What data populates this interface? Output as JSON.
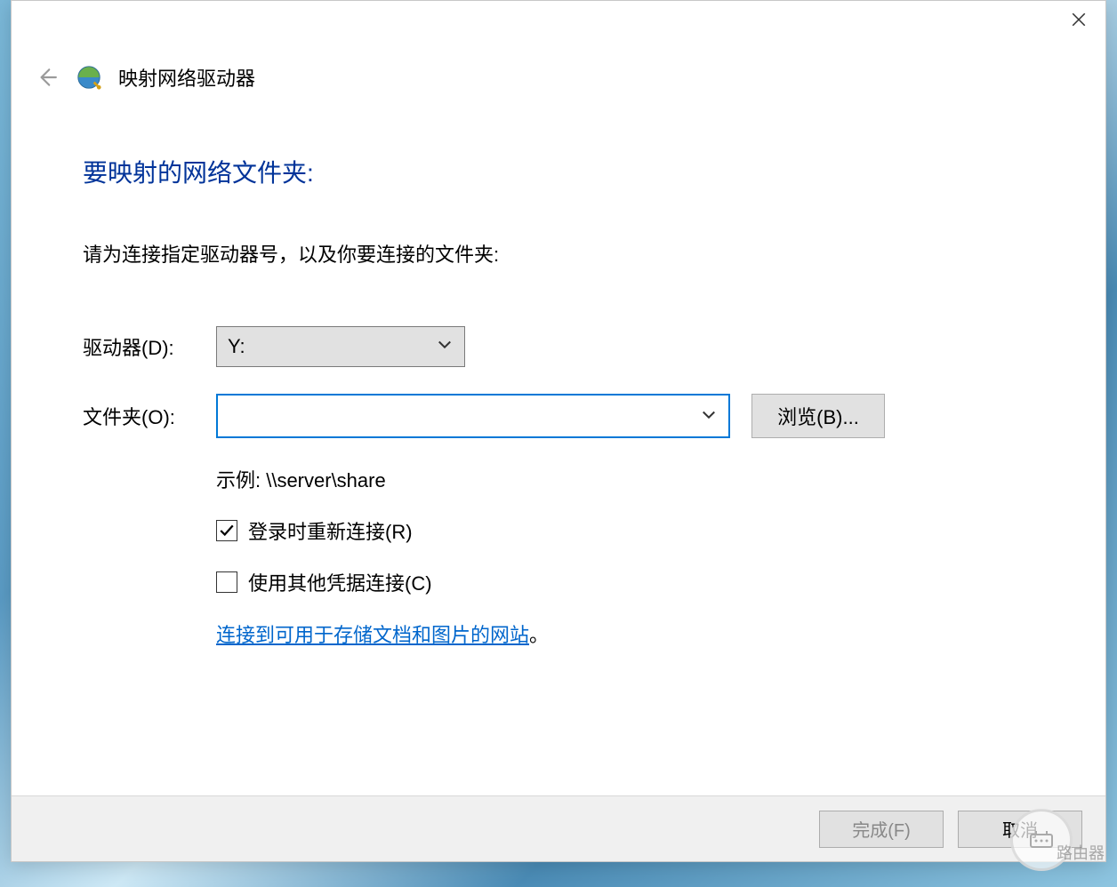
{
  "window": {
    "wizard_title": "映射网络驱动器"
  },
  "content": {
    "heading": "要映射的网络文件夹:",
    "instruction": "请为连接指定驱动器号，以及你要连接的文件夹:",
    "drive_label": "驱动器(D):",
    "drive_value": "Y:",
    "folder_label": "文件夹(O):",
    "folder_value": "",
    "browse_label": "浏览(B)...",
    "example_text": "示例: \\\\server\\share",
    "reconnect_label": "登录时重新连接(R)",
    "reconnect_checked": true,
    "other_creds_label": "使用其他凭据连接(C)",
    "other_creds_checked": false,
    "link_text": "连接到可用于存储文档和图片的网站",
    "link_period": "。"
  },
  "footer": {
    "finish_label": "完成(F)",
    "cancel_label": "取消"
  },
  "watermark": {
    "text": "路由器"
  }
}
